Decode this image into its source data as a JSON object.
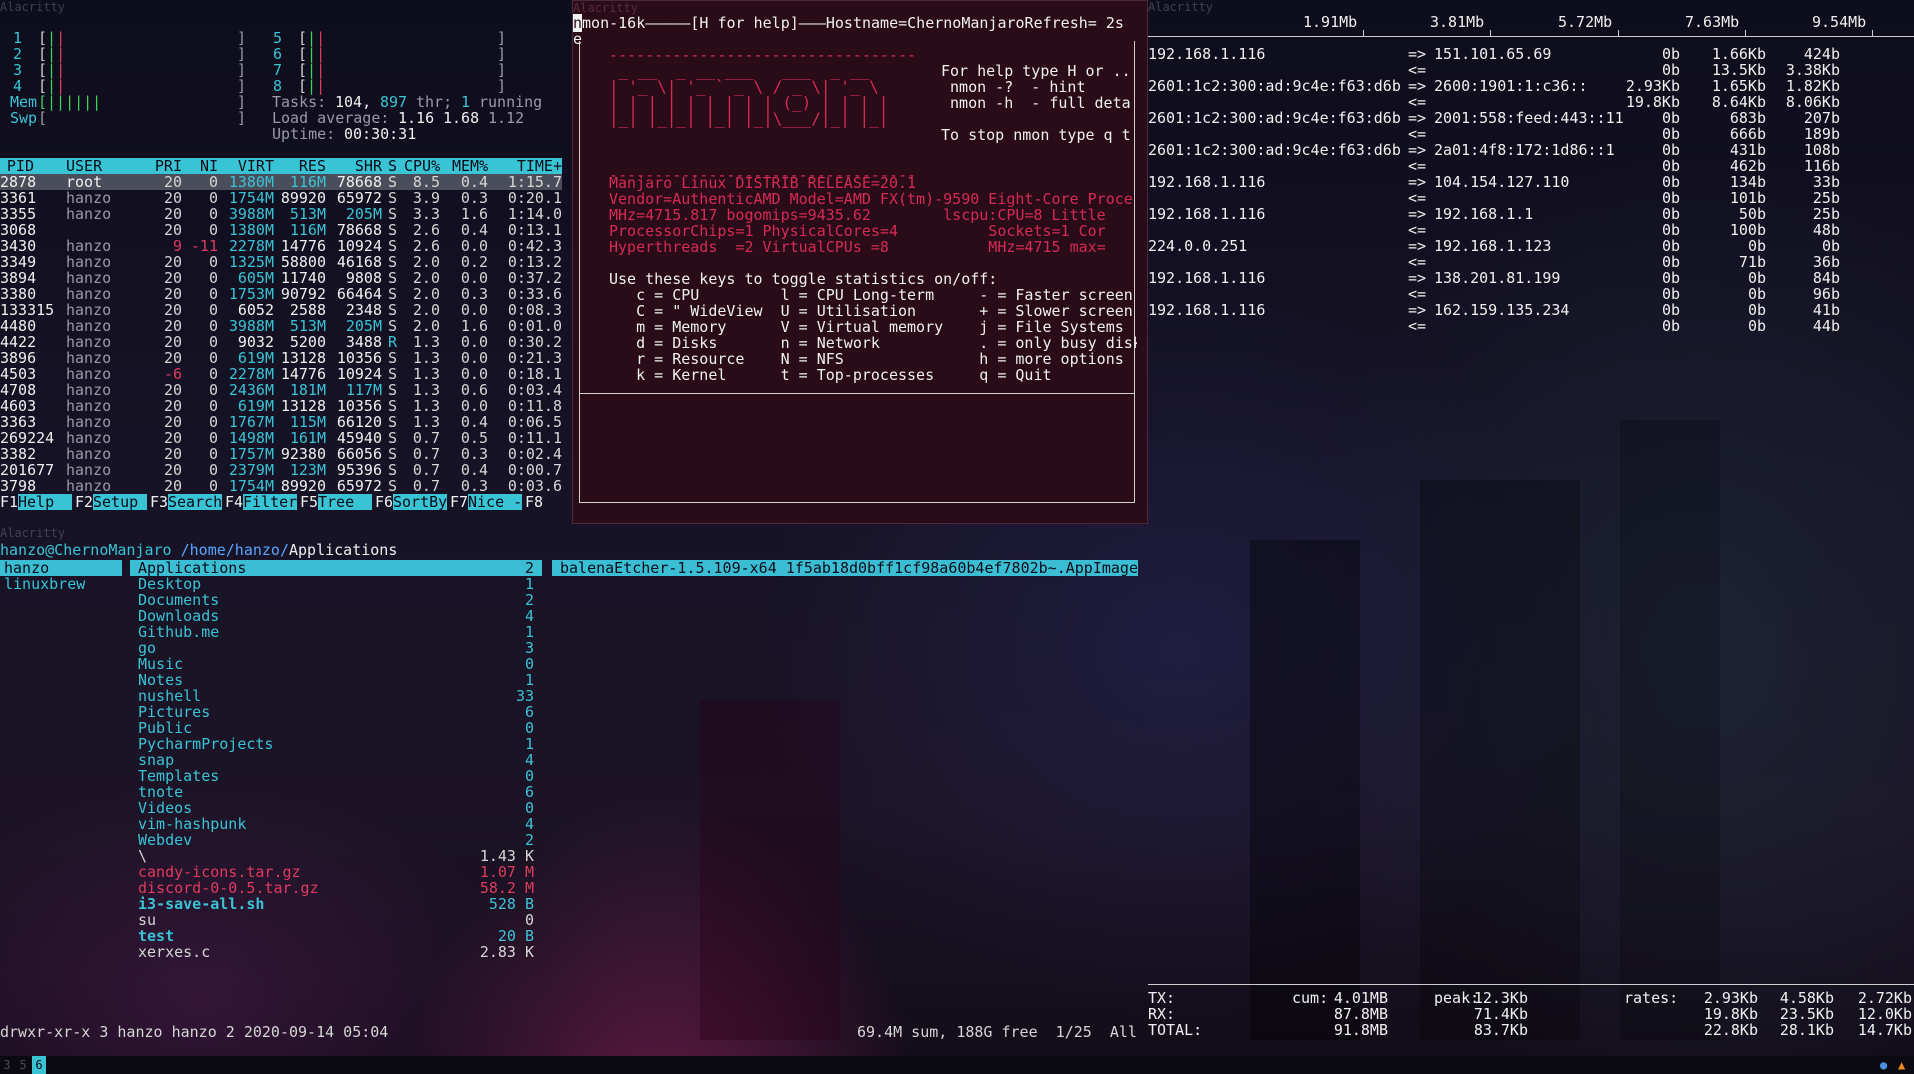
{
  "window_title": "Alacritty",
  "htop": {
    "cpus": [
      {
        "n": "1",
        "bar": "[||",
        "side": "left"
      },
      {
        "n": "2",
        "bar": "[||",
        "side": "left"
      },
      {
        "n": "3",
        "bar": "[||",
        "side": "left"
      },
      {
        "n": "4",
        "bar": "[||",
        "side": "left"
      },
      {
        "n": "5",
        "bar": "[||",
        "side": "right"
      },
      {
        "n": "6",
        "bar": "[||",
        "side": "right"
      },
      {
        "n": "7",
        "bar": "[||",
        "side": "right"
      },
      {
        "n": "8",
        "bar": "[||",
        "side": "right"
      }
    ],
    "mem_label": "Mem",
    "mem_bar": "[||||||",
    "swp_label": "Swp",
    "swp_bar": "[",
    "tasks_label": "Tasks:",
    "tasks_count": "104,",
    "threads": "897",
    "thr_label": "thr;",
    "running_count": "1",
    "running_label": "running",
    "load_label": "Load average:",
    "load_1": "1.16",
    "load_5": "1.68",
    "load_15": "1.12",
    "uptime_label": "Uptime:",
    "uptime": "00:30:31",
    "headers": [
      "PID",
      "USER",
      "PRI",
      "NI",
      "VIRT",
      "RES",
      "SHR",
      "S",
      "CPU%",
      "MEM%",
      "TIME+"
    ],
    "processes": [
      [
        "2878",
        "root",
        "20",
        "0",
        "1380M",
        "116M",
        "78668",
        "S",
        "8.5",
        "0.4",
        "1:15.7"
      ],
      [
        "3361",
        "hanzo",
        "20",
        "0",
        "1754M",
        "89920",
        "65972",
        "S",
        "3.9",
        "0.3",
        "0:20.1"
      ],
      [
        "3355",
        "hanzo",
        "20",
        "0",
        "3988M",
        "513M",
        "205M",
        "S",
        "3.3",
        "1.6",
        "1:14.0"
      ],
      [
        "3068",
        "",
        "20",
        "0",
        "1380M",
        "116M",
        "78668",
        "S",
        "2.6",
        "0.4",
        "0:13.1"
      ],
      [
        "3430",
        "hanzo",
        "9",
        "-11",
        "2278M",
        "14776",
        "10924",
        "S",
        "2.6",
        "0.0",
        "0:42.3"
      ],
      [
        "3349",
        "hanzo",
        "20",
        "0",
        "1325M",
        "58800",
        "46168",
        "S",
        "2.0",
        "0.2",
        "0:13.2"
      ],
      [
        "3894",
        "hanzo",
        "20",
        "0",
        "605M",
        "11740",
        "9808",
        "S",
        "2.0",
        "0.0",
        "0:37.2"
      ],
      [
        "3380",
        "hanzo",
        "20",
        "0",
        "1753M",
        "90792",
        "66464",
        "S",
        "2.0",
        "0.3",
        "0:33.6"
      ],
      [
        "133315",
        "hanzo",
        "20",
        "0",
        "6052",
        "2588",
        "2348",
        "S",
        "2.0",
        "0.0",
        "0:08.3"
      ],
      [
        "4480",
        "hanzo",
        "20",
        "0",
        "3988M",
        "513M",
        "205M",
        "S",
        "2.0",
        "1.6",
        "0:01.0"
      ],
      [
        "4422",
        "hanzo",
        "20",
        "0",
        "9032",
        "5200",
        "3488",
        "R",
        "1.3",
        "0.0",
        "0:30.2"
      ],
      [
        "3896",
        "hanzo",
        "20",
        "0",
        "619M",
        "13128",
        "10356",
        "S",
        "1.3",
        "0.0",
        "0:21.3"
      ],
      [
        "4503",
        "hanzo",
        "-6",
        "0",
        "2278M",
        "14776",
        "10924",
        "S",
        "1.3",
        "0.0",
        "0:18.1"
      ],
      [
        "4708",
        "hanzo",
        "20",
        "0",
        "2436M",
        "181M",
        "117M",
        "S",
        "1.3",
        "0.6",
        "0:03.4"
      ],
      [
        "4603",
        "hanzo",
        "20",
        "0",
        "619M",
        "13128",
        "10356",
        "S",
        "1.3",
        "0.0",
        "0:11.8"
      ],
      [
        "3363",
        "hanzo",
        "20",
        "0",
        "1767M",
        "115M",
        "66120",
        "S",
        "1.3",
        "0.4",
        "0:06.5"
      ],
      [
        "269224",
        "hanzo",
        "20",
        "0",
        "1498M",
        "161M",
        "45940",
        "S",
        "0.7",
        "0.5",
        "0:11.1"
      ],
      [
        "3382",
        "hanzo",
        "20",
        "0",
        "1757M",
        "92380",
        "66056",
        "S",
        "0.7",
        "0.3",
        "0:02.4"
      ],
      [
        "201677",
        "hanzo",
        "20",
        "0",
        "2379M",
        "123M",
        "95396",
        "S",
        "0.7",
        "0.4",
        "0:00.7"
      ],
      [
        "3798",
        "hanzo",
        "20",
        "0",
        "1754M",
        "89920",
        "65972",
        "S",
        "0.7",
        "0.3",
        "0:03.6"
      ]
    ],
    "fkeys": [
      {
        "key": "F1",
        "label": "Help"
      },
      {
        "key": "F2",
        "label": "Setup"
      },
      {
        "key": "F3",
        "label": "Search"
      },
      {
        "key": "F4",
        "label": "Filter"
      },
      {
        "key": "F5",
        "label": "Tree"
      },
      {
        "key": "F6",
        "label": "SortBy"
      },
      {
        "key": "F7",
        "label": "Nice -"
      },
      {
        "key": "F8",
        "label": ""
      }
    ]
  },
  "nmon": {
    "header": "nmon-16k—————[H for help]———Hostname=ChernoManjaroRefresh= 2s",
    "header_wrap": "e",
    "logo": [
      "----------------------------------",
      " _ __  _ __ ___   ___  _ __  ",
      "| '_ \\| '_ ` _ \\ / _ \\| '_ \\ ",
      "| | | | | | | | | (_) | | | |",
      "|_| |_|_| |_| |_|\\___/|_| |_|",
      "----------------------------------"
    ],
    "help_lines": [
      "For help type H or ..",
      " nmon -?  - hint",
      " nmon -h  - full deta",
      "",
      "To stop nmon type q t"
    ],
    "sys_lines": [
      "Manjaro Linux DISTRIB_RELEASE=20.1",
      "Vendor=AuthenticAMD Model=AMD FX(tm)-9590 Eight-Core Proce",
      "MHz=4715.817 bogomips=9435.62        lscpu:CPU=8 Little",
      "ProcessorChips=1 PhysicalCores=4          Sockets=1 Cor",
      "Hyperthreads  =2 VirtualCPUs =8           MHz=4715 max="
    ],
    "keys_title": "Use these keys to toggle statistics on/off:",
    "keys": [
      "   c = CPU         l = CPU Long-term     - = Faster screen",
      "   C = \" WideView  U = Utilisation       + = Slower screen",
      "   m = Memory      V = Virtual memory    j = File Systems",
      "   d = Disks       n = Network           . = only busy disk",
      "   r = Resource    N = NFS               h = more options",
      "   k = Kernel      t = Top-processes     q = Quit"
    ]
  },
  "iftop": {
    "scale": [
      "1.91Mb",
      "3.81Mb",
      "5.72Mb",
      "7.63Mb",
      "9.54Mb"
    ],
    "flows": [
      {
        "src": "192.168.1.116",
        "dst": "151.101.65.69",
        "out": [
          "0b",
          "1.66Kb",
          "424b"
        ],
        "in": [
          "0b",
          "13.5Kb",
          "3.38Kb"
        ]
      },
      {
        "src": "2601:1c2:300:ad:9c4e:f63:d6b",
        "dst": "2600:1901:1:c36::",
        "out": [
          "2.93Kb",
          "1.65Kb",
          "1.82Kb"
        ],
        "in": [
          "19.8Kb",
          "8.64Kb",
          "8.06Kb"
        ]
      },
      {
        "src": "2601:1c2:300:ad:9c4e:f63:d6b",
        "dst": "2001:558:feed:443::11",
        "out": [
          "0b",
          "683b",
          "207b"
        ],
        "in": [
          "0b",
          "666b",
          "189b"
        ]
      },
      {
        "src": "2601:1c2:300:ad:9c4e:f63:d6b",
        "dst": "2a01:4f8:172:1d86::1",
        "out": [
          "0b",
          "431b",
          "108b"
        ],
        "in": [
          "0b",
          "462b",
          "116b"
        ]
      },
      {
        "src": "192.168.1.116",
        "dst": "104.154.127.110",
        "out": [
          "0b",
          "134b",
          "33b"
        ],
        "in": [
          "0b",
          "101b",
          "25b"
        ]
      },
      {
        "src": "192.168.1.116",
        "dst": "192.168.1.1",
        "out": [
          "0b",
          "50b",
          "25b"
        ],
        "in": [
          "0b",
          "100b",
          "48b"
        ]
      },
      {
        "src": "224.0.0.251",
        "dst": "192.168.1.123",
        "out": [
          "0b",
          "0b",
          "0b"
        ],
        "in": [
          "0b",
          "71b",
          "36b"
        ]
      },
      {
        "src": "192.168.1.116",
        "dst": "138.201.81.199",
        "out": [
          "0b",
          "0b",
          "84b"
        ],
        "in": [
          "0b",
          "0b",
          "96b"
        ]
      },
      {
        "src": "192.168.1.116",
        "dst": "162.159.135.234",
        "out": [
          "0b",
          "0b",
          "41b"
        ],
        "in": [
          "0b",
          "0b",
          "44b"
        ]
      }
    ],
    "out_arrow": "=>",
    "in_arrow": "<=",
    "totals": [
      {
        "label": "TX:",
        "cum": "4.01MB",
        "peak": "12.3Kb",
        "rates": [
          "2.93Kb",
          "4.58Kb",
          "2.72Kb"
        ]
      },
      {
        "label": "RX:",
        "cum": "87.8MB",
        "peak": "71.4Kb",
        "rates": [
          "19.8Kb",
          "23.5Kb",
          "12.0Kb"
        ]
      },
      {
        "label": "TOTAL:",
        "cum": "91.8MB",
        "peak": "83.7Kb",
        "rates": [
          "22.8Kb",
          "28.1Kb",
          "14.7Kb"
        ]
      }
    ],
    "cum_label": "cum:",
    "peak_label": "peak:",
    "rates_label": "rates:"
  },
  "ranger": {
    "user_host": "hanzo@ChernoManjaro",
    "path_prefix": "/home/hanzo/",
    "path_current": "Applications",
    "parent": [
      "hanzo",
      "linuxbrew"
    ],
    "entries": [
      {
        "name": "Applications",
        "size": "2",
        "kind": "dir"
      },
      {
        "name": "Desktop",
        "size": "1",
        "kind": "dir"
      },
      {
        "name": "Documents",
        "size": "2",
        "kind": "dir"
      },
      {
        "name": "Downloads",
        "size": "4",
        "kind": "dir"
      },
      {
        "name": "Github.me",
        "size": "1",
        "kind": "dir"
      },
      {
        "name": "go",
        "size": "3",
        "kind": "dir"
      },
      {
        "name": "Music",
        "size": "0",
        "kind": "dir"
      },
      {
        "name": "Notes",
        "size": "1",
        "kind": "dir"
      },
      {
        "name": "nushell",
        "size": "33",
        "kind": "dir"
      },
      {
        "name": "Pictures",
        "size": "6",
        "kind": "dir"
      },
      {
        "name": "Public",
        "size": "0",
        "kind": "dir"
      },
      {
        "name": "PycharmProjects",
        "size": "1",
        "kind": "dir"
      },
      {
        "name": "snap",
        "size": "4",
        "kind": "dir"
      },
      {
        "name": "Templates",
        "size": "0",
        "kind": "dir"
      },
      {
        "name": "tnote",
        "size": "6",
        "kind": "dir"
      },
      {
        "name": "Videos",
        "size": "0",
        "kind": "dir"
      },
      {
        "name": "vim-hashpunk",
        "size": "4",
        "kind": "dir"
      },
      {
        "name": "Webdev",
        "size": "2",
        "kind": "dir"
      },
      {
        "name": "\\",
        "size": "1.43 K",
        "kind": "file"
      },
      {
        "name": "candy-icons.tar.gz",
        "size": "1.07 M",
        "kind": "archive"
      },
      {
        "name": "discord-0-0.5.tar.gz",
        "size": "58.2 M",
        "kind": "archive"
      },
      {
        "name": "i3-save-all.sh",
        "size": "528 B",
        "kind": "exec"
      },
      {
        "name": "su",
        "size": "0",
        "kind": "file"
      },
      {
        "name": "test",
        "size": "20 B",
        "kind": "exec"
      },
      {
        "name": "xerxes.c",
        "size": "2.83 K",
        "kind": "file"
      }
    ],
    "preview": "balenaEtcher-1.5.109-x64_1f5ab18d0bff1cf98a60b4ef7802b~.AppImage",
    "status_left": "drwxr-xr-x 3 hanzo hanzo 2 2020-09-14 05:04",
    "status_right": "69.4M sum, 188G free  1/25  All"
  },
  "bar": {
    "workspaces": [
      "3",
      "5",
      "6"
    ],
    "active": "6"
  }
}
